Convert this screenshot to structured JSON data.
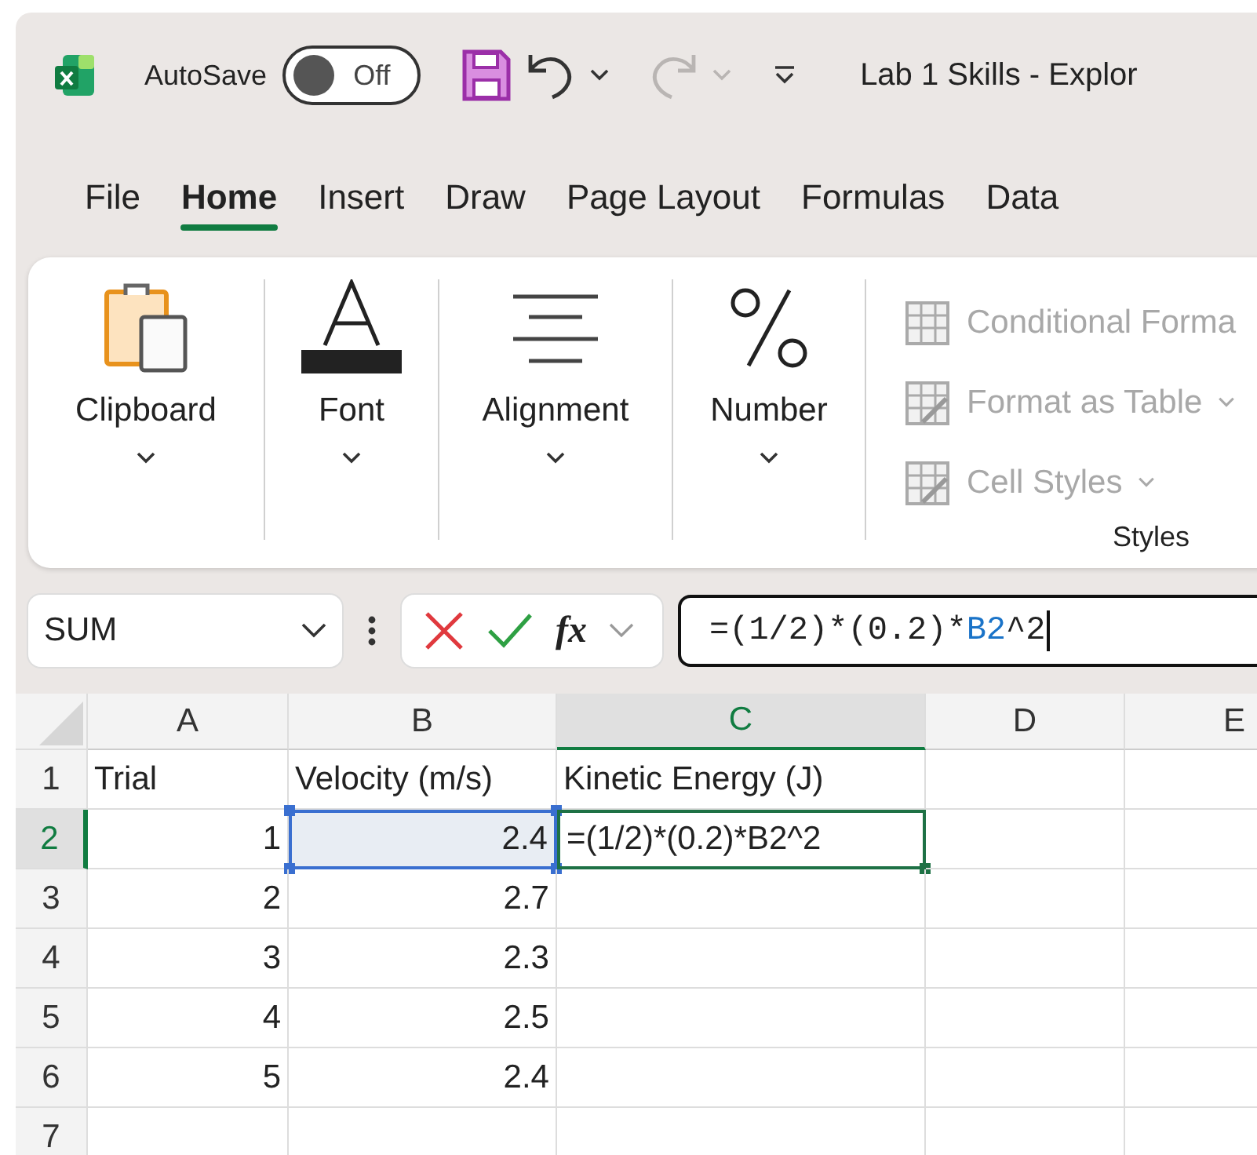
{
  "title_bar": {
    "autosave": {
      "label": "AutoSave",
      "on": false,
      "state_text": "Off"
    },
    "redo": {
      "disabled": true
    },
    "title": "Lab 1 Skills - Explor"
  },
  "tabs": [
    {
      "label": "File",
      "selected": false
    },
    {
      "label": "Home",
      "selected": true
    },
    {
      "label": "Insert",
      "selected": false
    },
    {
      "label": "Draw",
      "selected": false
    },
    {
      "label": "Page Layout",
      "selected": false
    },
    {
      "label": "Formulas",
      "selected": false
    },
    {
      "label": "Data",
      "selected": false
    }
  ],
  "ribbon": {
    "groups": [
      {
        "kind": "clipboard",
        "label": "Clipboard"
      },
      {
        "kind": "font",
        "label": "Font"
      },
      {
        "kind": "alignment",
        "label": "Alignment"
      },
      {
        "kind": "number",
        "label": "Number"
      }
    ],
    "styles": {
      "label": "Styles",
      "items": [
        {
          "kind": "conditional",
          "label": "Conditional Forma",
          "dropdown": false,
          "disabled": true
        },
        {
          "kind": "table",
          "label": "Format as Table",
          "dropdown": true,
          "disabled": true
        },
        {
          "kind": "cell",
          "label": "Cell Styles",
          "dropdown": true,
          "disabled": true
        }
      ]
    }
  },
  "formula_bar": {
    "name_box": "SUM",
    "fx": "fx",
    "formula": [
      {
        "text": "=(1/2)*(0.2)*",
        "kind": "plain"
      },
      {
        "text": "B2",
        "kind": "reference"
      },
      {
        "text": "^2",
        "kind": "plain"
      }
    ]
  },
  "sheet": {
    "columns": [
      {
        "label": "A",
        "selected": false
      },
      {
        "label": "B",
        "selected": false
      },
      {
        "label": "C",
        "selected": true
      },
      {
        "label": "D",
        "selected": false
      },
      {
        "label": "E",
        "selected": false
      }
    ],
    "rows": [
      {
        "number": "1",
        "selected": false,
        "cells": [
          {
            "kind": "text",
            "text": "Trial"
          },
          {
            "kind": "text",
            "text": "Velocity (m/s)"
          },
          {
            "kind": "text",
            "text": "Kinetic Energy (J)"
          },
          {
            "kind": "empty"
          },
          {
            "kind": "empty"
          }
        ]
      },
      {
        "number": "2",
        "selected": true,
        "cells": [
          {
            "kind": "number",
            "text": "1"
          },
          {
            "kind": "reference",
            "text": "2.4"
          },
          {
            "kind": "editing",
            "text": "=(1/2)*(0.2)*B2^2"
          },
          {
            "kind": "empty"
          },
          {
            "kind": "empty"
          }
        ]
      },
      {
        "number": "3",
        "selected": false,
        "cells": [
          {
            "kind": "number",
            "text": "2"
          },
          {
            "kind": "number",
            "text": "2.7"
          },
          {
            "kind": "empty"
          },
          {
            "kind": "empty"
          },
          {
            "kind": "empty"
          }
        ]
      },
      {
        "number": "4",
        "selected": false,
        "cells": [
          {
            "kind": "number",
            "text": "3"
          },
          {
            "kind": "number",
            "text": "2.3"
          },
          {
            "kind": "empty"
          },
          {
            "kind": "empty"
          },
          {
            "kind": "empty"
          }
        ]
      },
      {
        "number": "5",
        "selected": false,
        "cells": [
          {
            "kind": "number",
            "text": "4"
          },
          {
            "kind": "number",
            "text": "2.5"
          },
          {
            "kind": "empty"
          },
          {
            "kind": "empty"
          },
          {
            "kind": "empty"
          }
        ]
      },
      {
        "number": "6",
        "selected": false,
        "cells": [
          {
            "kind": "number",
            "text": "5"
          },
          {
            "kind": "number",
            "text": "2.4"
          },
          {
            "kind": "empty"
          },
          {
            "kind": "empty"
          },
          {
            "kind": "empty"
          }
        ]
      },
      {
        "number": "7",
        "selected": false,
        "cells": [
          {
            "kind": "empty"
          },
          {
            "kind": "empty"
          },
          {
            "kind": "empty"
          },
          {
            "kind": "empty"
          },
          {
            "kind": "empty"
          }
        ]
      }
    ]
  }
}
